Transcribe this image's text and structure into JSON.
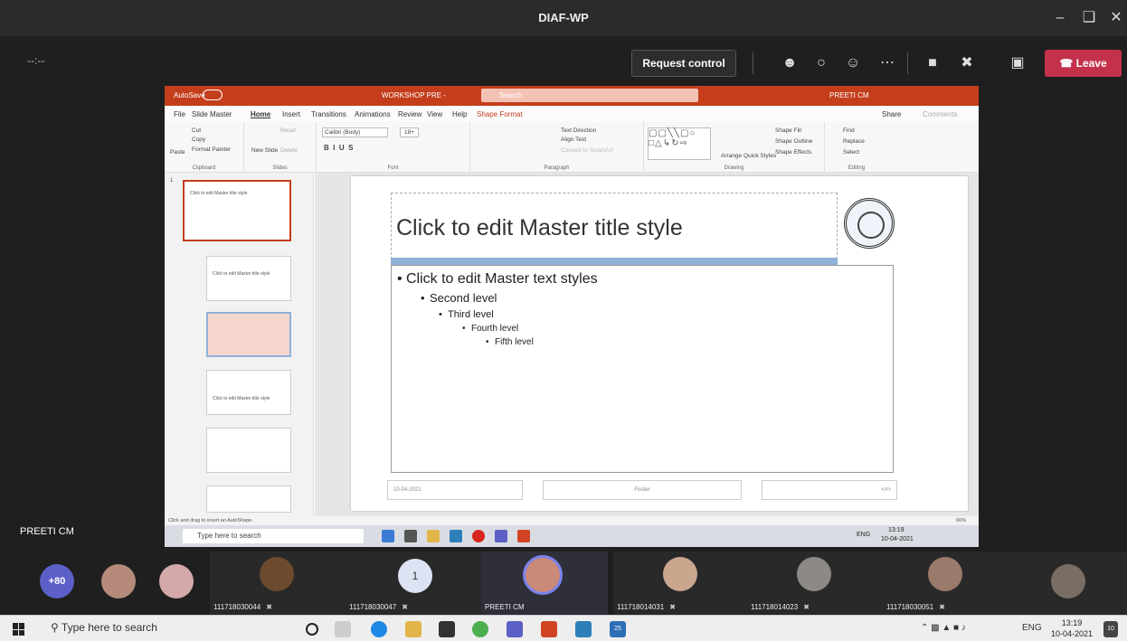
{
  "window": {
    "title": "DIAF-WP"
  },
  "meeting": {
    "timer": "--:--",
    "request_control": "Request control",
    "leave": "Leave",
    "presenter_name": "PREETI CM"
  },
  "shared_screen": {
    "app_title": "WORKSHOP PRE -",
    "autosave": "AutoSave",
    "search": "Search",
    "user": "PREETI CM",
    "tabs": [
      "File",
      "Slide Master",
      "Home",
      "Insert",
      "Transitions",
      "Animations",
      "Review",
      "View",
      "Help",
      "Shape Format"
    ],
    "share_label": "Share",
    "comments_label": "Comments",
    "ribbon": {
      "clipboard": {
        "paste": "Paste",
        "cut": "Cut",
        "copy": "Copy",
        "format_painter": "Format Painter",
        "label": "Clipboard"
      },
      "slides": {
        "new_slide": "New Slide",
        "reset": "Reset",
        "delete": "Delete",
        "label": "Slides"
      },
      "font": {
        "name": "Calibri (Body)",
        "size": "18+",
        "label": "Font"
      },
      "paragraph": {
        "text_direction": "Text Direction",
        "align_text": "Align Text",
        "convert": "Convert to SmartArt",
        "label": "Paragraph"
      },
      "drawing": {
        "arrange": "Arrange",
        "quick_styles": "Quick Styles",
        "shape_fill": "Shape Fill",
        "shape_outline": "Shape Outline",
        "shape_effects": "Shape Effects",
        "label": "Drawing"
      },
      "editing": {
        "find": "Find",
        "replace": "Replace",
        "select": "Select",
        "label": "Editing"
      }
    },
    "thumbnails": {
      "first_number": "1",
      "title_text": "Click to edit Master title style"
    },
    "slide": {
      "title": "Click to edit Master title style",
      "levels": [
        "Click to edit Master text styles",
        "Second level",
        "Third level",
        "Fourth level",
        "Fifth level"
      ],
      "date": "10-04-2021",
      "footer": "Footer",
      "page": "<#>"
    },
    "status_hint": "Click and drag to insert an AutoShape.",
    "zoom": "66%",
    "inner_taskbar": {
      "search": "Type here to search",
      "lang": "ENG",
      "time": "13:19",
      "date": "10-04-2021"
    }
  },
  "participants": [
    {
      "label": "+80"
    },
    {
      "label": ""
    },
    {
      "label": ""
    },
    {
      "label": "111718030044"
    },
    {
      "label": "111718030047",
      "badge": "1"
    },
    {
      "label": "PREETI CM"
    },
    {
      "label": "111718014031"
    },
    {
      "label": "111718014023"
    },
    {
      "label": "111718030051"
    },
    {
      "label": ""
    }
  ],
  "taskbar": {
    "search": "Type here to search",
    "lang": "ENG",
    "time": "13:19",
    "date": "10-04-2021",
    "notification_count": "10",
    "badge_count": "25"
  },
  "colors": {
    "ppt_red": "#c43e1c",
    "leave_red": "#c4314b",
    "teams_dark": "#1f1f1f"
  }
}
